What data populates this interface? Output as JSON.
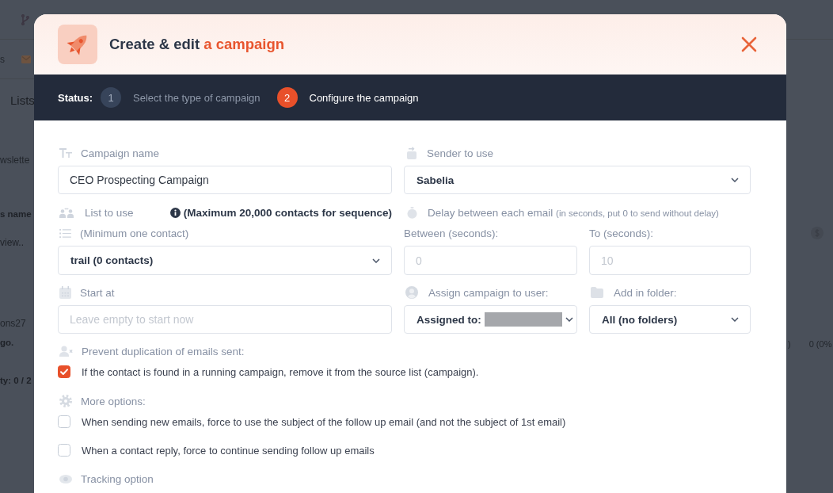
{
  "background": {
    "top_label": "s",
    "tab": "Lists",
    "left_texts": [
      {
        "text": "wslette",
        "kind": "plain"
      },
      {
        "text": "s name",
        "kind": "bold"
      },
      {
        "text": "view..",
        "kind": "placeholder"
      },
      {
        "text": "ons27",
        "kind": "plain"
      },
      {
        "text": "go.",
        "kind": "bold"
      },
      {
        "text": "ty: 0 / 2",
        "kind": "bold"
      }
    ],
    "right_texts": [
      ")",
      "0 (0%"
    ]
  },
  "dialog": {
    "title": "Create & edit",
    "title_accent": "a campaign"
  },
  "status": {
    "label": "Status:",
    "steps": [
      {
        "number": "1",
        "label": "Select the type of campaign",
        "selected": false
      },
      {
        "number": "2",
        "label": "Configure the campaign",
        "selected": true
      }
    ]
  },
  "form": {
    "campaign_name": {
      "label": "Campaign name",
      "value": "CEO Prospecting Campaign"
    },
    "sender": {
      "label": "Sender to use",
      "value": "Sabelia"
    },
    "list": {
      "label": "List to use",
      "note": "(Maximum 20,000 contacts for sequence)",
      "sublabel": "(Minimum one contact)",
      "value": "trail (0 contacts)"
    },
    "delay": {
      "label": "Delay between each email",
      "hint": "(in seconds, put 0 to send without delay)",
      "between": {
        "label": "Between (seconds):",
        "placeholder": "0"
      },
      "to": {
        "label": "To (seconds):",
        "placeholder": "10"
      }
    },
    "start_at": {
      "label": "Start at",
      "placeholder": "Leave empty to start now"
    },
    "assign": {
      "label": "Assign campaign to user:",
      "value": "Assigned to:",
      "redacted": true
    },
    "folder": {
      "label": "Add in folder:",
      "value": "All (no folders)"
    }
  },
  "prevent_duplication": {
    "label": "Prevent duplication of emails sent:",
    "options": [
      {
        "label": "If the contact is found in a running campaign, remove it from the source list (campaign).",
        "checked": true
      }
    ]
  },
  "more_options": {
    "label": "More options:",
    "options": [
      {
        "label": "When sending new emails, force to use the subject of the follow up email (and not the subject of 1st email)",
        "checked": false
      },
      {
        "label": "When a contact reply, force to continue sending follow up emails",
        "checked": false
      }
    ]
  },
  "tracking": {
    "label": "Tracking option"
  }
}
